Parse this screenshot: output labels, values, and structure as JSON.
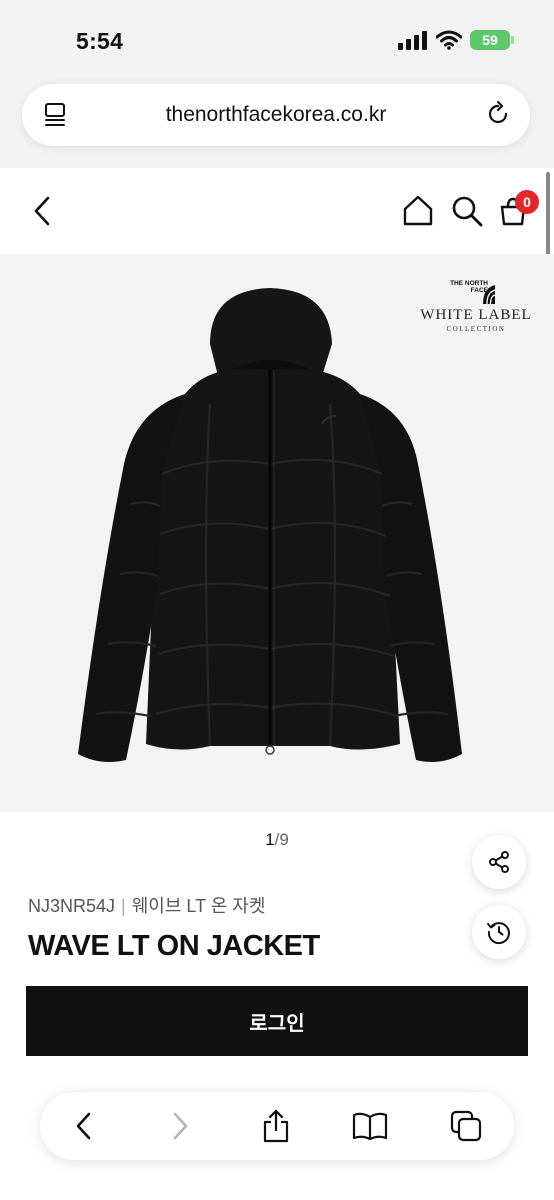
{
  "status_bar": {
    "time": "5:54",
    "battery": "59"
  },
  "browser": {
    "url": "thenorthfacekorea.co.kr"
  },
  "header": {
    "cart_count": "0"
  },
  "product_image": {
    "brand_mark": "THE NORTH FACE",
    "label_title": "WHITE LABEL",
    "label_subtitle": "COLLECTION",
    "gallery_progress": 0.111
  },
  "pager": {
    "current": "1",
    "separator": "/",
    "total": "9"
  },
  "product": {
    "code": "NJ3NR54J",
    "divider": "|",
    "korean_name": "웨이브 LT 온 자켓",
    "name": "WAVE LT ON JACKET"
  },
  "actions": {
    "login_label": "로그인"
  },
  "colors": {
    "badge": "#e4262a",
    "button": "#111111",
    "battery": "#5ec769"
  }
}
